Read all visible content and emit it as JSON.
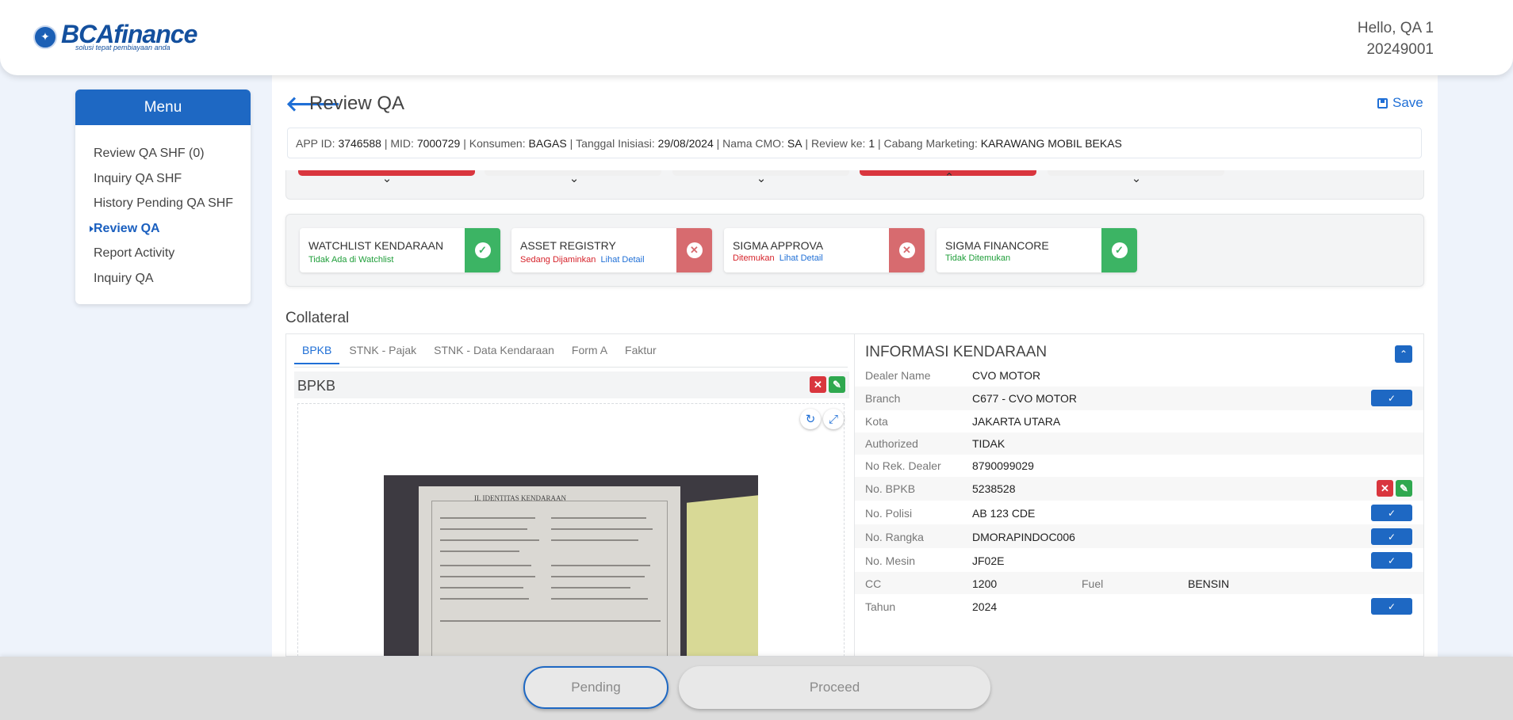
{
  "header": {
    "logo_brand": "BCAfinance",
    "logo_tagline": "solusi tepat pembiayaan anda",
    "greeting": "Hello, QA 1",
    "user_id": "20249001"
  },
  "sidebar": {
    "title": "Menu",
    "items": [
      {
        "label": "Review QA SHF (0)"
      },
      {
        "label": "Inquiry QA SHF"
      },
      {
        "label": "History Pending QA SHF"
      },
      {
        "label": "Review QA",
        "active": true
      },
      {
        "label": "Report Activity"
      },
      {
        "label": "Inquiry QA"
      }
    ]
  },
  "page": {
    "title": "Review QA",
    "save_label": "Save",
    "info": {
      "app_id_label": "APP ID:",
      "app_id": "3746588",
      "mid_label": "MID:",
      "mid": "7000729",
      "konsumen_label": "Konsumen:",
      "konsumen": "BAGAS",
      "tanggal_label": "Tanggal Inisiasi:",
      "tanggal": "29/08/2024",
      "cmo_label": "Nama CMO:",
      "cmo": "SA",
      "review_label": "Review ke:",
      "review": "1",
      "cabang_label": "Cabang Marketing:",
      "cabang": "KARAWANG MOBIL BEKAS"
    }
  },
  "checks": [
    {
      "title": "WATCHLIST KENDARAAN",
      "status": "Tidak Ada di Watchlist",
      "status_color": "green",
      "link": "",
      "result": "ok"
    },
    {
      "title": "ASSET REGISTRY",
      "status": "Sedang Dijaminkan",
      "status_color": "red",
      "link": "Lihat Detail",
      "result": "fail"
    },
    {
      "title": "SIGMA APPROVA",
      "status": "Ditemukan",
      "status_color": "red",
      "link": "Lihat Detail",
      "result": "fail"
    },
    {
      "title": "SIGMA FINANCORE",
      "status": "Tidak Ditemukan",
      "status_color": "green",
      "link": "",
      "result": "ok"
    }
  ],
  "collateral": {
    "title": "Collateral",
    "tabs": [
      "BPKB",
      "STNK - Pajak",
      "STNK - Data Kendaraan",
      "Form A",
      "Faktur"
    ],
    "active_tab": "BPKB",
    "doc_label": "BPKB",
    "doc_image_heading": "II. IDENTITAS KENDARAAN"
  },
  "vehicle_info": {
    "title": "INFORMASI KENDARAAN",
    "rows": [
      {
        "label": "Dealer Name",
        "value": "CVO MOTOR"
      },
      {
        "label": "Branch",
        "value": "C677 - CVO MOTOR"
      },
      {
        "label": "Kota",
        "value": "JAKARTA UTARA"
      },
      {
        "label": "Authorized",
        "value": "TIDAK"
      },
      {
        "label": "No Rek. Dealer",
        "value": "8790099029"
      },
      {
        "label": "No. BPKB",
        "value": "5238528"
      },
      {
        "label": "No. Polisi",
        "value": "AB 123 CDE"
      },
      {
        "label": "No. Rangka",
        "value": "DMORAPINDOC006"
      },
      {
        "label": "No. Mesin",
        "value": "JF02E"
      },
      {
        "label": "CC",
        "value": "1200",
        "label2": "Fuel",
        "value2": "BENSIN"
      },
      {
        "label": "Tahun",
        "value": "2024"
      }
    ]
  },
  "footer": {
    "pending_label": "Pending",
    "proceed_label": "Proceed"
  },
  "colors": {
    "primary": "#1e68c3",
    "success": "#3cb464",
    "danger": "#d76b6f"
  }
}
